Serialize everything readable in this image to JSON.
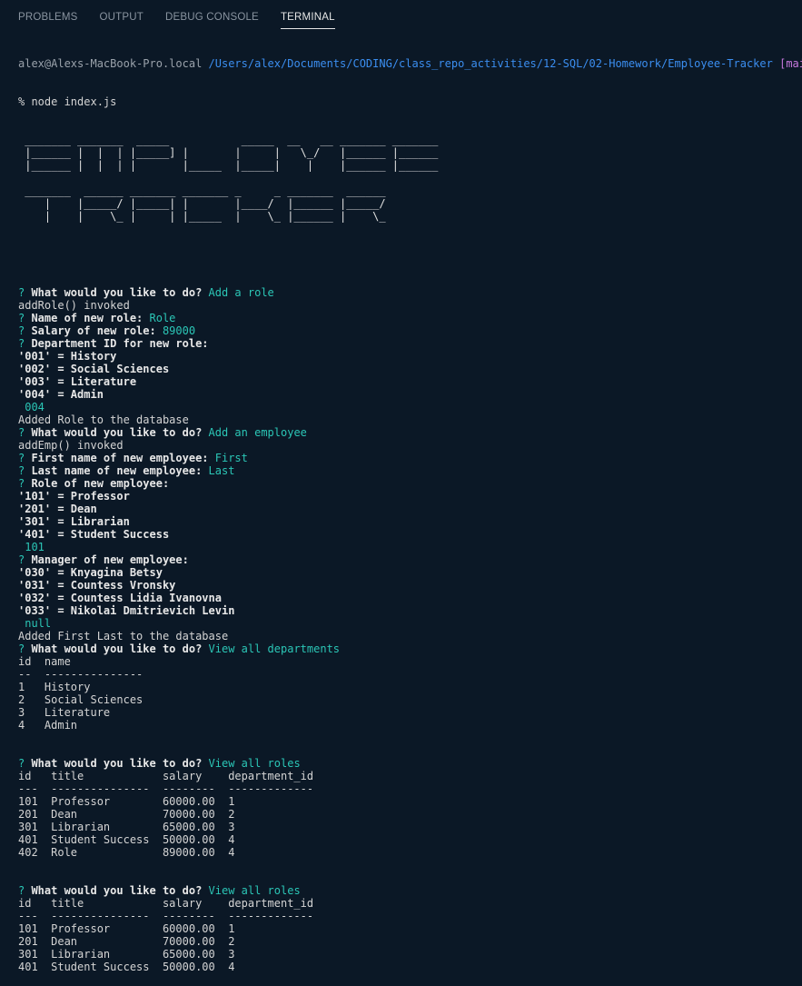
{
  "tabs": [
    {
      "label": "PROBLEMS"
    },
    {
      "label": "OUTPUT"
    },
    {
      "label": "DEBUG CONSOLE"
    },
    {
      "label": "TERMINAL"
    }
  ],
  "active_tab": "TERMINAL",
  "prompt": {
    "host": "alex@Alexs-MacBook-Pro.local",
    "path": "/Users/alex/Documents/CODING/class_repo_activities/12-SQL/02-Homework/Employee-Tracker",
    "branch": "[main]",
    "command": "% node index.js"
  },
  "banner": [
    " _______ _______  _____           _____  __   __ _______ _______",
    " |______ |  |  | |_____] |       |     |   \\_/   |______ |______",
    " |______ |  |  | |       |_____  |_____|    |    |______ |______",
    "",
    " _______  ______ _______ _______ _     _ _______  ______",
    "    |    |_____/ |_____| |       |____/  |______ |_____/",
    "    |    |    \\_ |     | |_____  |    \\_ |______ |    \\_"
  ],
  "lines": [
    {
      "segs": [
        {
          "t": "? ",
          "c": "cyan"
        },
        {
          "t": "What would you like to do? ",
          "c": "bold"
        },
        {
          "t": "Add a role",
          "c": "cyan"
        }
      ]
    },
    {
      "segs": [
        {
          "t": "addRole() invoked",
          "c": ""
        }
      ]
    },
    {
      "segs": [
        {
          "t": "? ",
          "c": "cyan"
        },
        {
          "t": "Name of new role: ",
          "c": "bold"
        },
        {
          "t": "Role",
          "c": "cyan"
        }
      ]
    },
    {
      "segs": [
        {
          "t": "? ",
          "c": "cyan"
        },
        {
          "t": "Salary of new role: ",
          "c": "bold"
        },
        {
          "t": "89000",
          "c": "cyan"
        }
      ]
    },
    {
      "segs": [
        {
          "t": "? ",
          "c": "cyan"
        },
        {
          "t": "Department ID for new role:",
          "c": "bold"
        }
      ]
    },
    {
      "segs": [
        {
          "t": "'001' = History",
          "c": "bold"
        }
      ]
    },
    {
      "segs": [
        {
          "t": "'002' = Social Sciences",
          "c": "bold"
        }
      ]
    },
    {
      "segs": [
        {
          "t": "'003' = Literature",
          "c": "bold"
        }
      ]
    },
    {
      "segs": [
        {
          "t": "'004' = Admin",
          "c": "bold"
        }
      ]
    },
    {
      "segs": [
        {
          "t": " 004",
          "c": "cyan"
        }
      ]
    },
    {
      "segs": [
        {
          "t": "Added Role to the database",
          "c": ""
        }
      ]
    },
    {
      "segs": [
        {
          "t": "? ",
          "c": "cyan"
        },
        {
          "t": "What would you like to do? ",
          "c": "bold"
        },
        {
          "t": "Add an employee",
          "c": "cyan"
        }
      ]
    },
    {
      "segs": [
        {
          "t": "addEmp() invoked",
          "c": ""
        }
      ]
    },
    {
      "segs": [
        {
          "t": "? ",
          "c": "cyan"
        },
        {
          "t": "First name of new employee: ",
          "c": "bold"
        },
        {
          "t": "First",
          "c": "cyan"
        }
      ]
    },
    {
      "segs": [
        {
          "t": "? ",
          "c": "cyan"
        },
        {
          "t": "Last name of new employee: ",
          "c": "bold"
        },
        {
          "t": "Last",
          "c": "cyan"
        }
      ]
    },
    {
      "segs": [
        {
          "t": "? ",
          "c": "cyan"
        },
        {
          "t": "Role of new employee:",
          "c": "bold"
        }
      ]
    },
    {
      "segs": [
        {
          "t": "'101' = Professor",
          "c": "bold"
        }
      ]
    },
    {
      "segs": [
        {
          "t": "'201' = Dean",
          "c": "bold"
        }
      ]
    },
    {
      "segs": [
        {
          "t": "'301' = Librarian",
          "c": "bold"
        }
      ]
    },
    {
      "segs": [
        {
          "t": "'401' = Student Success",
          "c": "bold"
        }
      ]
    },
    {
      "segs": [
        {
          "t": " 101",
          "c": "cyan"
        }
      ]
    },
    {
      "segs": [
        {
          "t": "? ",
          "c": "cyan"
        },
        {
          "t": "Manager of new employee:",
          "c": "bold"
        }
      ]
    },
    {
      "segs": [
        {
          "t": "'030' = Knyagina Betsy",
          "c": "bold"
        }
      ]
    },
    {
      "segs": [
        {
          "t": "'031' = Countess Vronsky",
          "c": "bold"
        }
      ]
    },
    {
      "segs": [
        {
          "t": "'032' = Countess Lidia Ivanovna",
          "c": "bold"
        }
      ]
    },
    {
      "segs": [
        {
          "t": "'033' = Nikolai Dmitrievich Levin",
          "c": "bold"
        }
      ]
    },
    {
      "segs": [
        {
          "t": " null",
          "c": "cyan"
        }
      ]
    },
    {
      "segs": [
        {
          "t": "Added First Last to the database",
          "c": ""
        }
      ]
    },
    {
      "segs": [
        {
          "t": "? ",
          "c": "cyan"
        },
        {
          "t": "What would you like to do? ",
          "c": "bold"
        },
        {
          "t": "View all departments",
          "c": "cyan"
        }
      ]
    },
    {
      "segs": [
        {
          "t": "id  name",
          "c": ""
        }
      ]
    },
    {
      "segs": [
        {
          "t": "--  ---------------",
          "c": ""
        }
      ]
    },
    {
      "segs": [
        {
          "t": "1   History",
          "c": ""
        }
      ]
    },
    {
      "segs": [
        {
          "t": "2   Social Sciences",
          "c": ""
        }
      ]
    },
    {
      "segs": [
        {
          "t": "3   Literature",
          "c": ""
        }
      ]
    },
    {
      "segs": [
        {
          "t": "4   Admin",
          "c": ""
        }
      ]
    },
    {
      "segs": [
        {
          "t": "",
          "c": ""
        }
      ]
    },
    {
      "segs": [
        {
          "t": "",
          "c": ""
        }
      ]
    },
    {
      "segs": [
        {
          "t": "? ",
          "c": "cyan"
        },
        {
          "t": "What would you like to do? ",
          "c": "bold"
        },
        {
          "t": "View all roles",
          "c": "cyan"
        }
      ]
    },
    {
      "segs": [
        {
          "t": "id   title            salary    department_id",
          "c": ""
        }
      ]
    },
    {
      "segs": [
        {
          "t": "---  ---------------  --------  -------------",
          "c": ""
        }
      ]
    },
    {
      "segs": [
        {
          "t": "101  Professor        60000.00  1",
          "c": ""
        }
      ]
    },
    {
      "segs": [
        {
          "t": "201  Dean             70000.00  2",
          "c": ""
        }
      ]
    },
    {
      "segs": [
        {
          "t": "301  Librarian        65000.00  3",
          "c": ""
        }
      ]
    },
    {
      "segs": [
        {
          "t": "401  Student Success  50000.00  4",
          "c": ""
        }
      ]
    },
    {
      "segs": [
        {
          "t": "402  Role             89000.00  4",
          "c": ""
        }
      ]
    },
    {
      "segs": [
        {
          "t": "",
          "c": ""
        }
      ]
    },
    {
      "segs": [
        {
          "t": "",
          "c": ""
        }
      ]
    },
    {
      "segs": [
        {
          "t": "? ",
          "c": "cyan"
        },
        {
          "t": "What would you like to do? ",
          "c": "bold"
        },
        {
          "t": "View all roles",
          "c": "cyan"
        }
      ]
    },
    {
      "segs": [
        {
          "t": "id   title            salary    department_id",
          "c": ""
        }
      ]
    },
    {
      "segs": [
        {
          "t": "---  ---------------  --------  -------------",
          "c": ""
        }
      ]
    },
    {
      "segs": [
        {
          "t": "101  Professor        60000.00  1",
          "c": ""
        }
      ]
    },
    {
      "segs": [
        {
          "t": "201  Dean             70000.00  2",
          "c": ""
        }
      ]
    },
    {
      "segs": [
        {
          "t": "301  Librarian        65000.00  3",
          "c": ""
        }
      ]
    },
    {
      "segs": [
        {
          "t": "401  Student Success  50000.00  4",
          "c": ""
        }
      ]
    }
  ]
}
